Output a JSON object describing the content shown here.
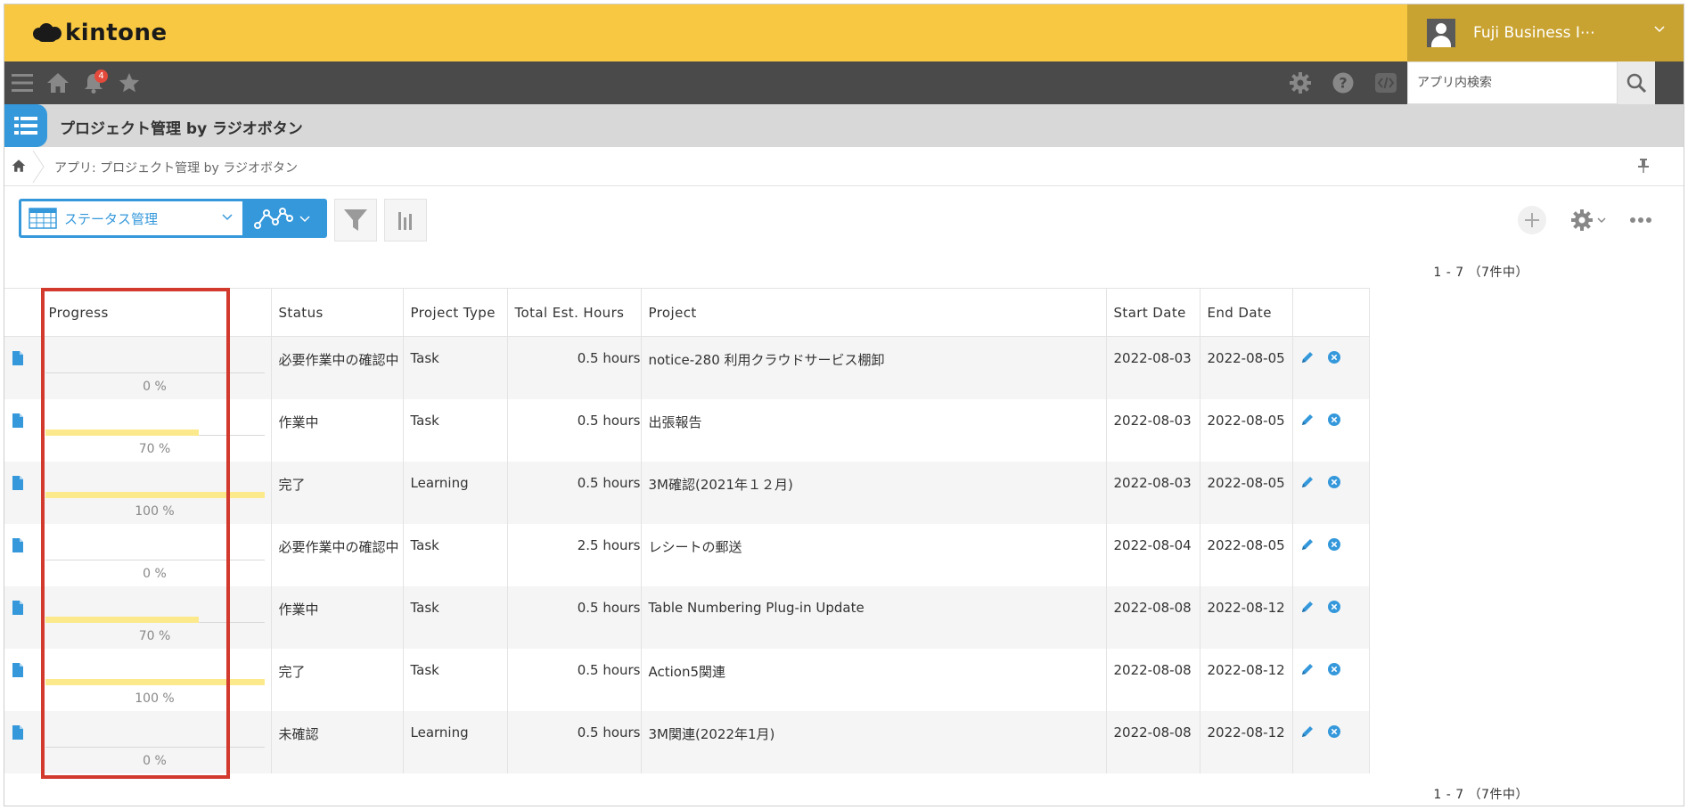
{
  "header": {
    "logo_text": "kintone",
    "user_name": "Fuji Business I⋯",
    "notification_count": "4"
  },
  "search": {
    "placeholder": "アプリ内検索"
  },
  "app": {
    "title": "プロジェクト管理 by ラジオボタン",
    "breadcrumb": "アプリ: プロジェクト管理 by ラジオボタン"
  },
  "toolbar": {
    "view_label": "ステータス管理"
  },
  "paging": {
    "text": "1 - 7 （7件中）"
  },
  "table": {
    "columns": [
      "Progress",
      "Status",
      "Project Type",
      "Total Est. Hours",
      "Project",
      "Start Date",
      "End Date"
    ],
    "rows": [
      {
        "progress": 0,
        "progress_label": "0 %",
        "status": "必要作業中の確認中",
        "type": "Task",
        "hours": "0.5 hours",
        "project": "notice-280 利用クラウドサービス棚卸",
        "start": "2022-08-03",
        "end": "2022-08-05"
      },
      {
        "progress": 70,
        "progress_label": "70 %",
        "status": "作業中",
        "type": "Task",
        "hours": "0.5 hours",
        "project": "出張報告",
        "start": "2022-08-03",
        "end": "2022-08-05"
      },
      {
        "progress": 100,
        "progress_label": "100 %",
        "status": "完了",
        "type": "Learning",
        "hours": "0.5 hours",
        "project": "3M確認(2021年１２月)",
        "start": "2022-08-03",
        "end": "2022-08-05"
      },
      {
        "progress": 0,
        "progress_label": "0 %",
        "status": "必要作業中の確認中",
        "type": "Task",
        "hours": "2.5 hours",
        "project": "レシートの郵送",
        "start": "2022-08-04",
        "end": "2022-08-05"
      },
      {
        "progress": 70,
        "progress_label": "70 %",
        "status": "作業中",
        "type": "Task",
        "hours": "0.5 hours",
        "project": "Table Numbering Plug-in Update",
        "start": "2022-08-08",
        "end": "2022-08-12"
      },
      {
        "progress": 100,
        "progress_label": "100 %",
        "status": "完了",
        "type": "Task",
        "hours": "0.5 hours",
        "project": "Action5関連",
        "start": "2022-08-08",
        "end": "2022-08-12"
      },
      {
        "progress": 0,
        "progress_label": "0 %",
        "status": "未確認",
        "type": "Learning",
        "hours": "0.5 hours",
        "project": "3M関連(2022年1月)",
        "start": "2022-08-08",
        "end": "2022-08-12"
      }
    ]
  },
  "colors": {
    "header_yellow": "#f8c842",
    "nav_dark": "#4a4a4a",
    "accent_blue": "#3498db",
    "progress_fill": "#fce98c",
    "highlight_red": "#d23a2e"
  },
  "icons": [
    "menu-icon",
    "home-icon",
    "bell-icon",
    "star-icon",
    "gear-icon",
    "help-icon",
    "code-icon",
    "search-icon",
    "list-icon",
    "pin-icon",
    "table-icon",
    "graph-icon",
    "filter-icon",
    "chart-icon",
    "plus-icon",
    "more-icon",
    "record-icon",
    "edit-icon",
    "delete-icon"
  ]
}
